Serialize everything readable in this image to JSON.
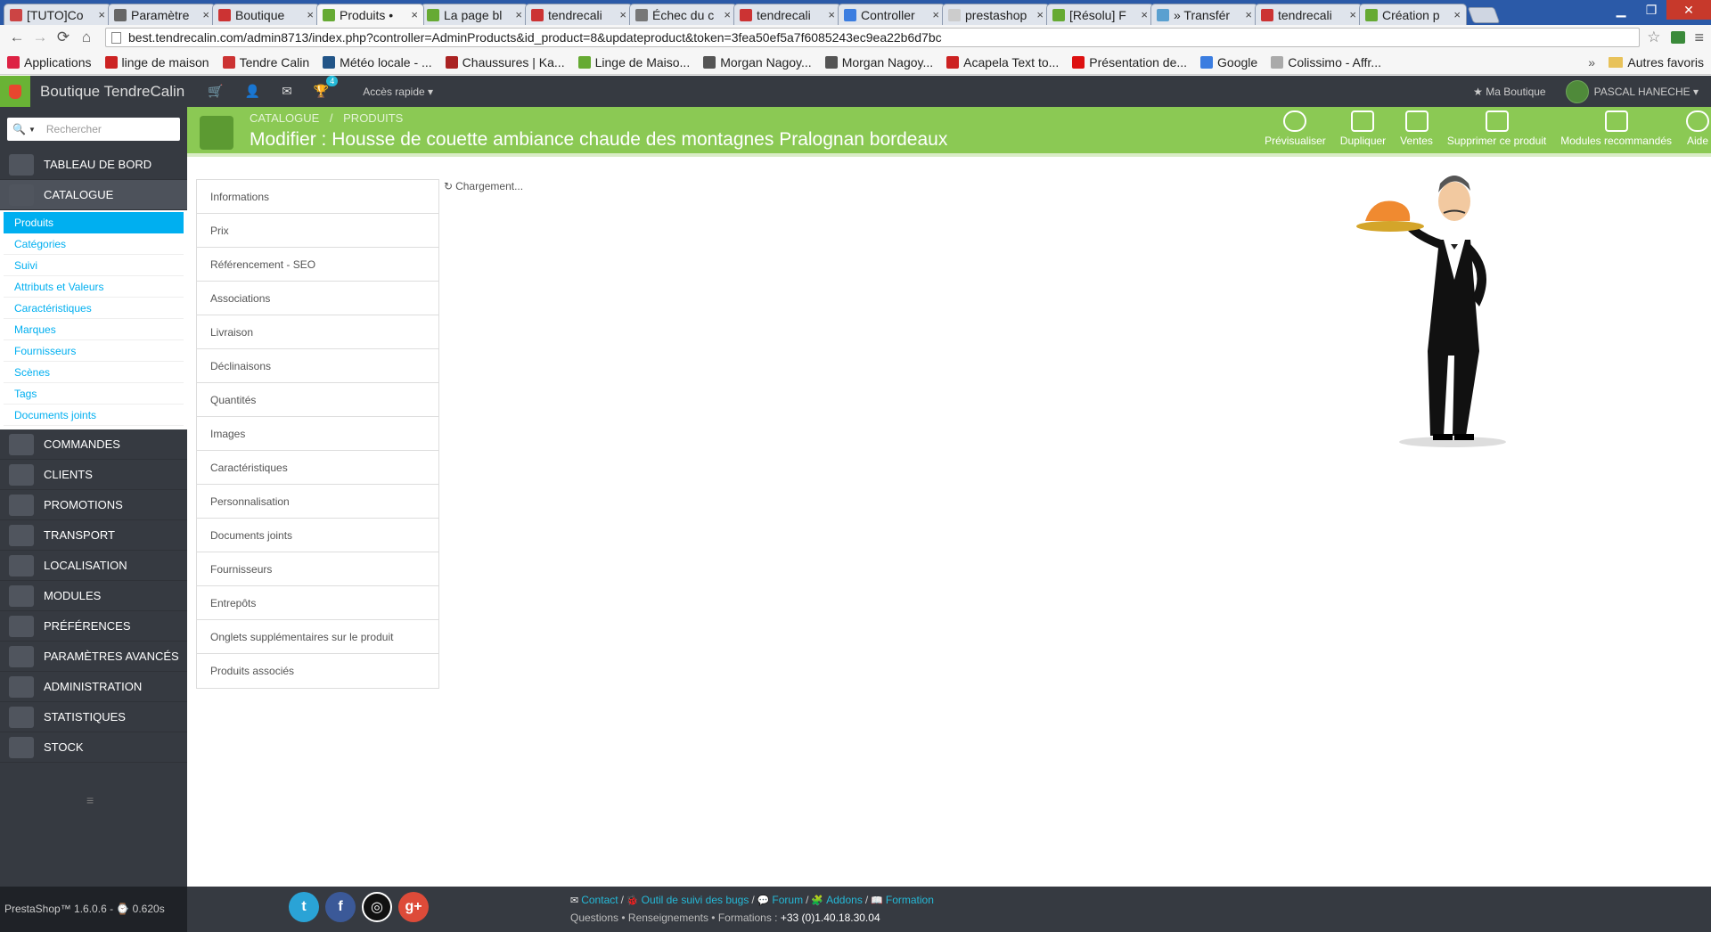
{
  "browser": {
    "tabs": [
      {
        "label": "[TUTO]Co",
        "color": "#c44"
      },
      {
        "label": "Paramètre",
        "color": "#666"
      },
      {
        "label": "Boutique",
        "color": "#c33"
      },
      {
        "label": "Produits •",
        "color": "#6a3",
        "active": true
      },
      {
        "label": "La page bl",
        "color": "#6a3"
      },
      {
        "label": "tendrecali",
        "color": "#c33"
      },
      {
        "label": "Échec du c",
        "color": "#777"
      },
      {
        "label": "tendrecali",
        "color": "#c33"
      },
      {
        "label": "Controller",
        "color": "#3b7de0"
      },
      {
        "label": "prestashop",
        "color": "#ccc"
      },
      {
        "label": "[Résolu] F",
        "color": "#6a3"
      },
      {
        "label": "» Transfér",
        "color": "#5aa0d0"
      },
      {
        "label": "tendrecali",
        "color": "#c33"
      },
      {
        "label": "Création p",
        "color": "#6a3"
      }
    ],
    "tab_close": "×",
    "url": "best.tendrecalin.com/admin8713/index.php?controller=AdminProducts&id_product=8&updateproduct&token=3fea50ef5a7f6085243ec9ea22b6d7bc",
    "bookmarks": [
      {
        "label": "Applications",
        "color": "#d24"
      },
      {
        "label": "linge de maison",
        "color": "#c22"
      },
      {
        "label": "Tendre Calin",
        "color": "#c33"
      },
      {
        "label": "Météo locale - ...",
        "color": "#258"
      },
      {
        "label": "Chaussures | Ka...",
        "color": "#a22"
      },
      {
        "label": "Linge de Maiso...",
        "color": "#6a3"
      },
      {
        "label": "Morgan Nagoy...",
        "color": "#555"
      },
      {
        "label": "Morgan Nagoy...",
        "color": "#555"
      },
      {
        "label": "Acapela Text to...",
        "color": "#c22"
      },
      {
        "label": "Présentation de...",
        "color": "#d11"
      },
      {
        "label": "Google",
        "color": "#3b7de0"
      },
      {
        "label": "Colissimo - Affr...",
        "color": "#aaa"
      }
    ],
    "bookmarks_more": "»",
    "other_bookmarks": "Autres favoris"
  },
  "header": {
    "shop_name": "Boutique TendreCalin",
    "notification_count": "4",
    "quick_access": "Accès rapide ▾",
    "my_shop": "★ Ma Boutique",
    "user": "PASCAL HANECHE ▾"
  },
  "sidebar": {
    "search_placeholder": "Rechercher",
    "items": [
      {
        "label": "TABLEAU DE BORD"
      },
      {
        "label": "CATALOGUE",
        "active": true
      },
      {
        "label": "COMMANDES"
      },
      {
        "label": "CLIENTS"
      },
      {
        "label": "PROMOTIONS"
      },
      {
        "label": "TRANSPORT"
      },
      {
        "label": "LOCALISATION"
      },
      {
        "label": "MODULES"
      },
      {
        "label": "PRÉFÉRENCES"
      },
      {
        "label": "PARAMÈTRES AVANCÉS"
      },
      {
        "label": "ADMINISTRATION"
      },
      {
        "label": "STATISTIQUES"
      },
      {
        "label": "STOCK"
      }
    ],
    "catalogue_sub": [
      "Produits",
      "Catégories",
      "Suivi",
      "Attributs et Valeurs",
      "Caractéristiques",
      "Marques",
      "Fournisseurs",
      "Scènes",
      "Tags",
      "Documents joints"
    ]
  },
  "page": {
    "breadcrumb": [
      "CATALOGUE",
      "/",
      "PRODUITS"
    ],
    "title": "Modifier : Housse de couette ambiance chaude des montagnes Pralognan bordeaux",
    "toolbar": [
      "Prévisualiser",
      "Dupliquer",
      "Ventes",
      "Supprimer ce produit",
      "Modules recommandés",
      "Aide"
    ],
    "product_tabs": [
      "Informations",
      "Prix",
      "Référencement - SEO",
      "Associations",
      "Livraison",
      "Déclinaisons",
      "Quantités",
      "Images",
      "Caractéristiques",
      "Personnalisation",
      "Documents joints",
      "Fournisseurs",
      "Entrepôts",
      "Onglets supplémentaires sur le produit",
      "Produits associés"
    ],
    "loading": "Chargement..."
  },
  "footer": {
    "version": "PrestaShop™ 1.6.0.6 - ⌚ 0.620s",
    "links": [
      "Contact",
      "Outil de suivi des bugs",
      "Forum",
      "Addons",
      "Formation"
    ],
    "contact_prefix": "Questions • Renseignements • Formations :",
    "phone": "+33 (0)1.40.18.30.04"
  },
  "colors": {
    "accent_green": "#8bc954",
    "link_blue": "#00aff0",
    "dark": "#363a41"
  }
}
